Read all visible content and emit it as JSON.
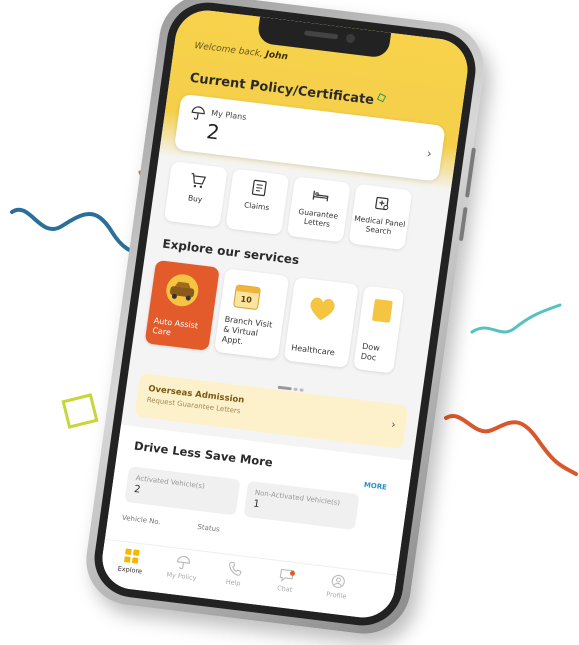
{
  "header": {
    "welcome_prefix": "Welcome back,",
    "user_name": "John"
  },
  "policy": {
    "title": "Current Policy/Certificate",
    "plans_label": "My Plans",
    "plans_count": "2"
  },
  "quick_actions": [
    {
      "label": "Buy",
      "icon": "cart-icon"
    },
    {
      "label": "Claims",
      "icon": "claims-doc-icon"
    },
    {
      "label": "Guarantee Letters",
      "icon": "bed-icon"
    },
    {
      "label": "Medical Panel Search",
      "icon": "clinic-search-icon"
    }
  ],
  "services": {
    "title": "Explore our services",
    "items": [
      {
        "label": "Auto Assist Care",
        "icon": "car-icon",
        "active": true
      },
      {
        "label": "Branch Visit & Virtual Appt.",
        "icon": "calendar-icon",
        "calendar_day": "10"
      },
      {
        "label": "Healthcare",
        "icon": "heart-icon"
      },
      {
        "label": "Dow Doc",
        "icon": "document-icon"
      }
    ]
  },
  "overseas": {
    "title": "Overseas Admission",
    "subtitle": "Request Guarantee Letters"
  },
  "drive": {
    "title": "Drive Less Save More",
    "more_label": "MORE",
    "activated_label": "Activated Vehicle(s)",
    "activated_value": "2",
    "non_activated_label": "Non-Activated Vehicle(s)",
    "non_activated_value": "1",
    "col_vehicle": "Vehicle No.",
    "col_status": "Status"
  },
  "nav": {
    "items": [
      {
        "label": "Explore",
        "icon": "explore-grid-icon",
        "active": true
      },
      {
        "label": "My Policy",
        "icon": "umbrella-icon"
      },
      {
        "label": "Help",
        "icon": "phone-icon"
      },
      {
        "label": "Chat",
        "icon": "chat-icon"
      },
      {
        "label": "Profile",
        "icon": "profile-icon"
      }
    ]
  },
  "colors": {
    "brand_yellow": "#f7d24a",
    "accent_orange": "#e35a2b",
    "link_blue": "#2b8fc7",
    "squiggle_blue": "#2a6f9a",
    "squiggle_teal": "#55c2c0",
    "squiggle_orange": "#d9572a",
    "triangle_orange": "#e56a3b",
    "square_lime": "#c8d63a"
  }
}
